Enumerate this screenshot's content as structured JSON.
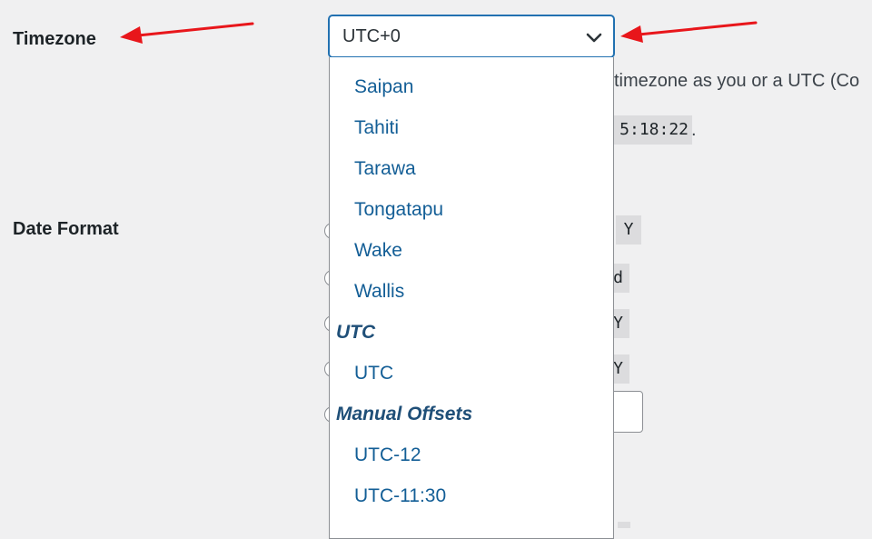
{
  "settings": {
    "timezone_label": "Timezone",
    "date_format_label": "Date Format",
    "timezone_description_partial": "timezone as you or a UTC (Co",
    "utc_time_partial": "5:18:22",
    "utc_time_suffix": ".",
    "date_format_samples": [
      "Y",
      "d",
      "Y",
      "Y"
    ]
  },
  "timezone_select": {
    "selected_value": "UTC+0",
    "chevron_icon": "chevron-down-icon",
    "dropdown": {
      "options_top": [
        "Saipan",
        "Tahiti",
        "Tarawa",
        "Tongatapu",
        "Wake",
        "Wallis"
      ],
      "group_utc": "UTC",
      "options_utc": [
        "UTC"
      ],
      "group_manual": "Manual Offsets",
      "options_manual": [
        "UTC-12",
        "UTC-11:30"
      ]
    }
  },
  "annotations": {
    "arrow_color": "#e8161b",
    "arrows": [
      "arrow-to-timezone-label",
      "arrow-to-timezone-select"
    ]
  },
  "colors": {
    "page_bg": "#f0f0f1",
    "option_text": "#135e96",
    "group_text": "#1f4f78",
    "focus_border": "#2271b1"
  }
}
